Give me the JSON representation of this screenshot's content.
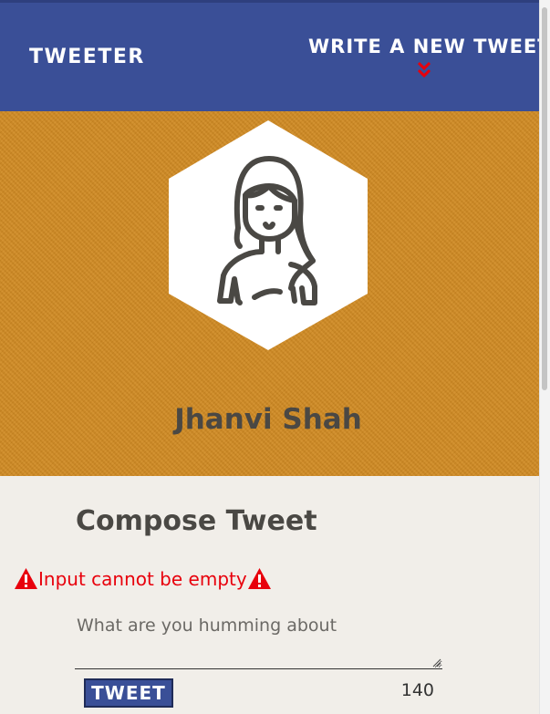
{
  "nav": {
    "brand": "TWEETER",
    "new_tweet_label": "WRITE A NEW TWEET",
    "chevron_icon": "double-chevron-down-icon",
    "chevron_color": "#e8000c",
    "background": "#3a4f97"
  },
  "profile": {
    "avatar_icon": "woman-avatar-icon",
    "name": "Jhanvi Shah",
    "banner_color": "#d08a22"
  },
  "compose": {
    "title": "Compose Tweet",
    "error_message": "Input cannot be empty",
    "error_icon": "warning-triangle-icon",
    "error_color": "#e8000c",
    "placeholder": "What are you humming about",
    "value": "",
    "submit_label": "TWEET",
    "char_counter": "140"
  }
}
